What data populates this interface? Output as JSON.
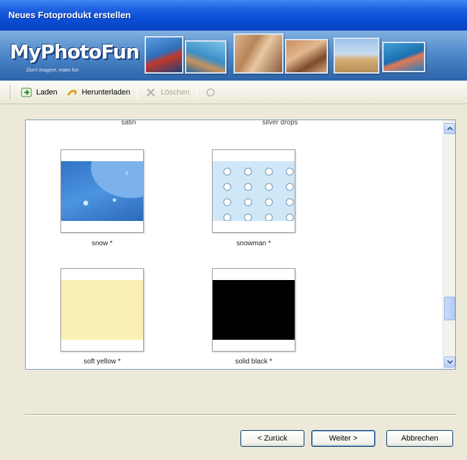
{
  "window": {
    "title": "Neues Fotoprodukt erstellen"
  },
  "banner": {
    "logo": "MyPhotoFun",
    "tagline": "Don't imagine, make fun"
  },
  "toolbar": {
    "load_label": "Laden",
    "download_label": "Herunterladen",
    "delete_label": "Löschen"
  },
  "gallery": {
    "top_labels": [
      "satin",
      "silver drops"
    ],
    "items": [
      {
        "label": "snow *",
        "swatch": "#3f7fcf"
      },
      {
        "label": "snowman *",
        "swatch": "#cfe7f6"
      },
      {
        "label": "soft yellow *",
        "swatch": "#fbf0b4"
      },
      {
        "label": "solid black *",
        "swatch": "#000000"
      }
    ]
  },
  "buttons": {
    "back": "< Zurück",
    "next": "Weiter >",
    "cancel": "Abbrechen"
  },
  "colors": {
    "title_bar": "#0a4fd6",
    "dialog_bg": "#ece9d8"
  }
}
